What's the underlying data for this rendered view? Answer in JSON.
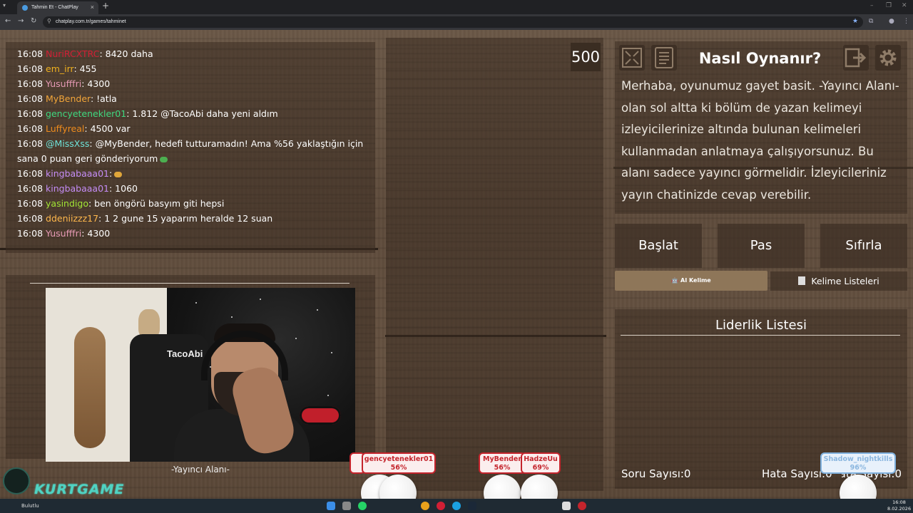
{
  "browser": {
    "tab_title": "Tahmin Et - ChatPlay",
    "url": "chatplay.com.tr/games/tahminet"
  },
  "chat": {
    "lines": [
      {
        "time": "16:08",
        "user": "NuriRCXTRC",
        "user_color": "#d11f35",
        "msg": ": 8420 daha"
      },
      {
        "time": "16:08",
        "user": "em_irr",
        "user_color": "#f0b11f",
        "msg": ": 455"
      },
      {
        "time": "16:08",
        "user": "Yusufffri",
        "user_color": "#e79ab5",
        "msg": ": 4300"
      },
      {
        "time": "16:08",
        "user": "MyBender",
        "user_color": "#f3a63a",
        "msg": ": !atla"
      },
      {
        "time": "16:08",
        "user": "gencyetenekler01",
        "user_color": "#3ed77f",
        "msg": ": 1.812 @TacoAbi daha yeni aldım"
      },
      {
        "time": "16:08",
        "user": "Luffyreal",
        "user_color": "#ef8c1d",
        "msg": ": 4500 var"
      },
      {
        "time": "16:08",
        "user": "@MissXss",
        "user_color": "#6fe3d9",
        "msg": ": @MyBender, hedefi tutturamadın! Ama %56 yaklaştığın için sana 0 puan geri gönderiyorum",
        "emote": "#4caf50"
      },
      {
        "time": "16:08",
        "user": "kingbabaaa01",
        "user_color": "#c48cf5",
        "msg": ":",
        "emote": "#e0a63a"
      },
      {
        "time": "16:08",
        "user": "kingbabaaa01",
        "user_color": "#c48cf5",
        "msg": ": 1060"
      },
      {
        "time": "16:08",
        "user": "yasindigo",
        "user_color": "#a3e635",
        "msg": ": ben öngörü basyım giti hepsi"
      },
      {
        "time": "16:08",
        "user": "ddeniizzz17",
        "user_color": "#ffb84d",
        "msg": ": 1 2 gune 15 yaparım heralde 12 suan"
      },
      {
        "time": "16:08",
        "user": "Yusufffri",
        "user_color": "#e79ab5",
        "msg": ": 4300"
      }
    ]
  },
  "streamer": {
    "label": "-Yayıncı Alanı-",
    "chair_logo": "TacoAbi"
  },
  "game": {
    "score": "500"
  },
  "howto": {
    "title": "Nasıl Oynanır?",
    "text": "Merhaba, oyunumuz gayet basit. -Yayıncı Alanı- olan sol altta ki bölüm de yazan kelimeyi izleyicilerinize altında bulunan kelimeleri kullanmadan anlatmaya çalışıyorsunuz. Bu alanı sadece yayıncı görmelidir. İzleyicileriniz yayın chatinizde cevap verebilir."
  },
  "controls": {
    "start": "Başlat",
    "pass": "Pas",
    "reset": "Sıfırla",
    "tab_ai": "AI Kelime",
    "tab_lists": "Kelime Listeleri"
  },
  "leaderboard": {
    "title": "Liderlik Listesi",
    "question_count": "Soru Sayısı:0",
    "error_count": "Hata Sayısı:0",
    "third_stat": "Hata Sayısı:0"
  },
  "players": [
    {
      "name": "gencyetenekler01",
      "pct": "56%"
    },
    {
      "name": "MyBender",
      "pct": "56%"
    },
    {
      "name": "HadzeUu",
      "pct": "69%"
    },
    {
      "name": "Shadow_nightkills",
      "pct": "96%"
    }
  ],
  "overlay": {
    "logo_a": "KURT",
    "logo_b": "GAME"
  },
  "taskbar": {
    "status": "Bulutlu",
    "time": "16:08",
    "date": "8.02.2026"
  },
  "colors": {
    "accent_red": "#c4242c",
    "wood": "#5f4c3c",
    "tab_active": "#8e7659"
  }
}
